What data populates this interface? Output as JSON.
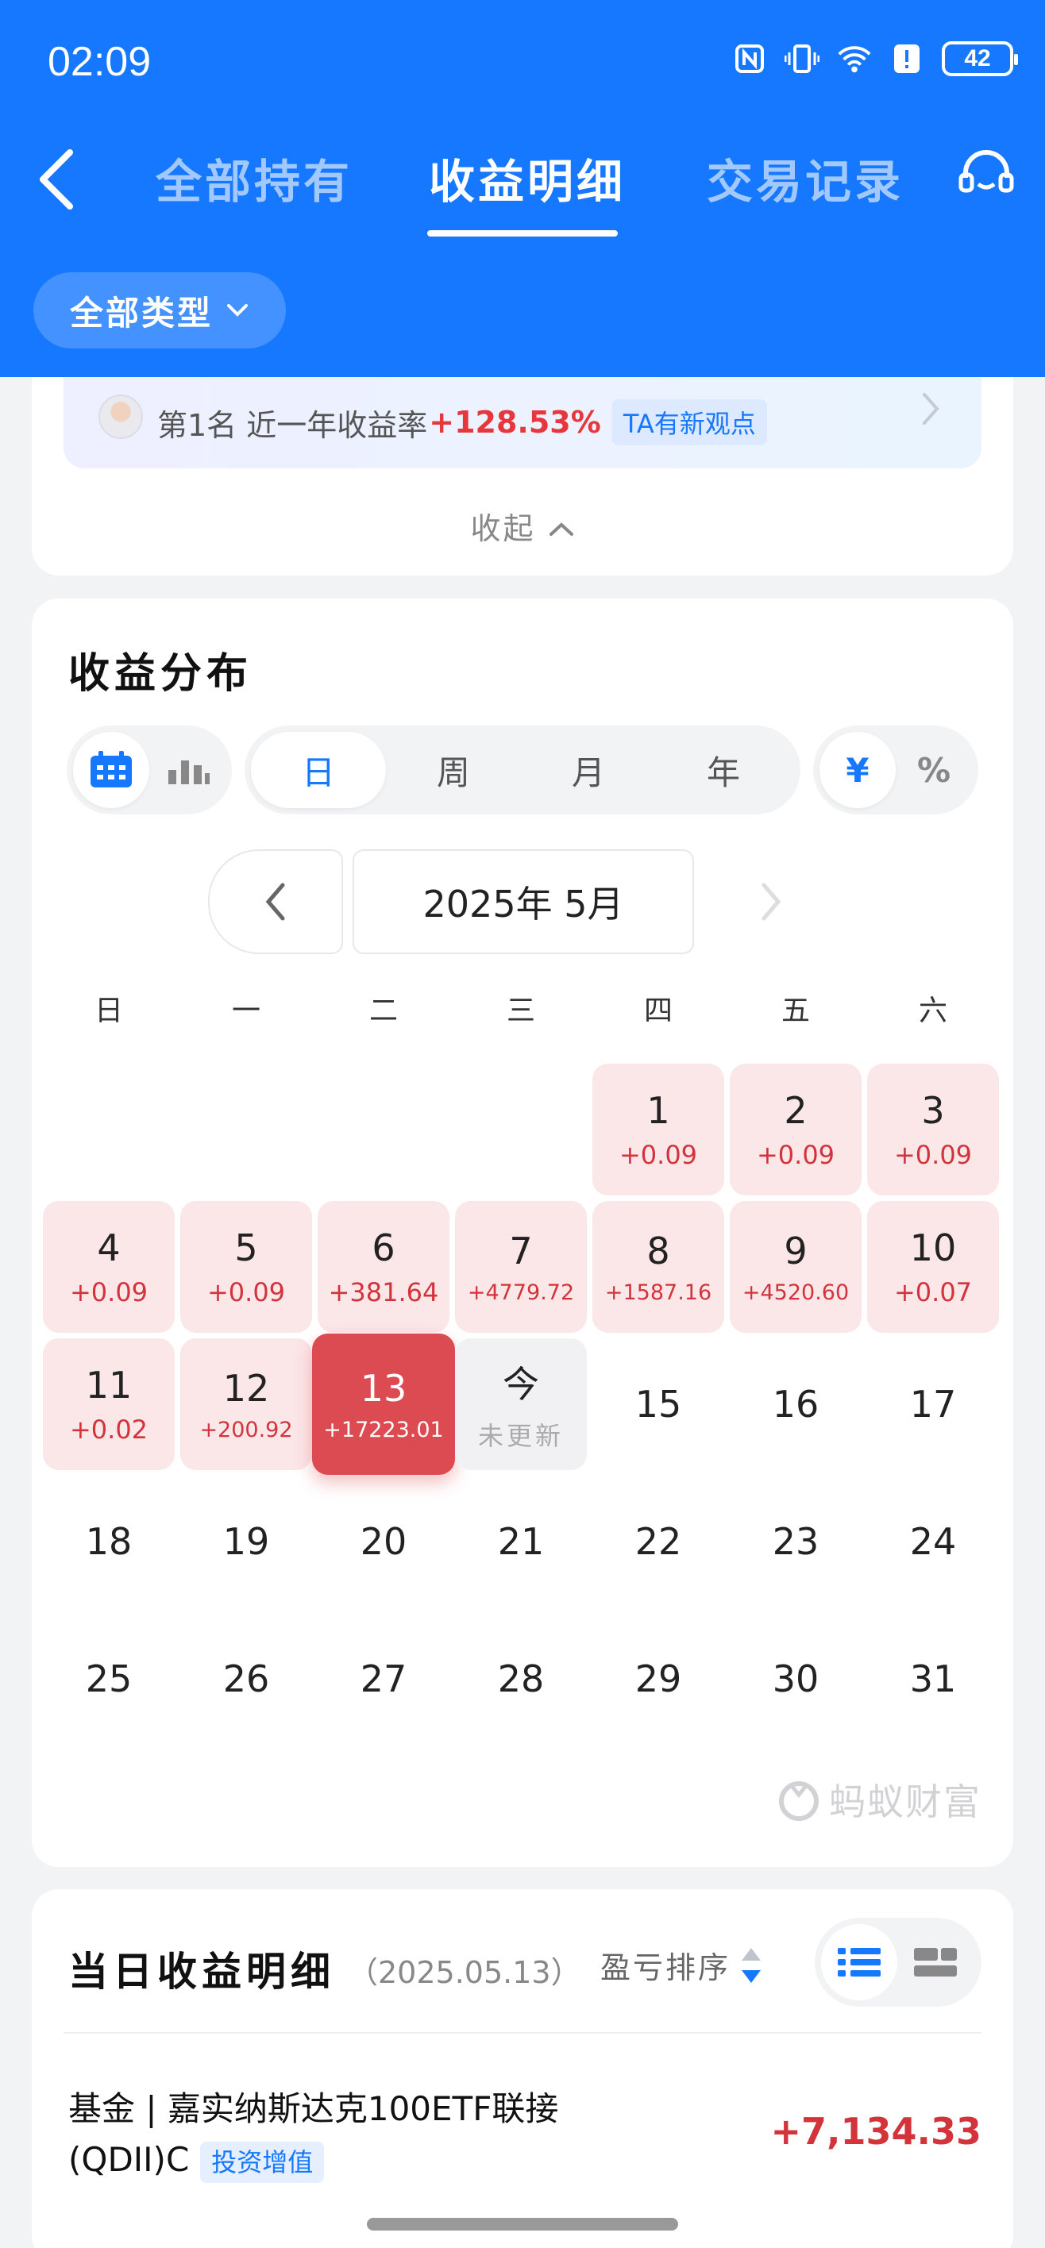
{
  "status": {
    "time": "02:09",
    "battery": "42"
  },
  "nav": {
    "tabs": [
      {
        "label": "全部持有"
      },
      {
        "label": "收益明细"
      },
      {
        "label": "交易记录"
      }
    ]
  },
  "filter": {
    "label": "全部类型"
  },
  "rank": {
    "text": "第1名 近一年收益率",
    "rate": "+128.53%",
    "badge": "TA有新观点",
    "collapse": "收起"
  },
  "calendar": {
    "title": "收益分布",
    "periods": [
      "日",
      "周",
      "月",
      "年"
    ],
    "units": [
      "¥",
      "%"
    ],
    "month": "2025年 5月",
    "weekdays": [
      "日",
      "一",
      "二",
      "三",
      "四",
      "五",
      "六"
    ],
    "days": [
      {
        "d": "1",
        "v": "+0.09"
      },
      {
        "d": "2",
        "v": "+0.09"
      },
      {
        "d": "3",
        "v": "+0.09"
      },
      {
        "d": "4",
        "v": "+0.09"
      },
      {
        "d": "5",
        "v": "+0.09"
      },
      {
        "d": "6",
        "v": "+381.64"
      },
      {
        "d": "7",
        "v": "+4779.72"
      },
      {
        "d": "8",
        "v": "+1587.16"
      },
      {
        "d": "9",
        "v": "+4520.60"
      },
      {
        "d": "10",
        "v": "+0.07"
      },
      {
        "d": "11",
        "v": "+0.02"
      },
      {
        "d": "12",
        "v": "+200.92"
      },
      {
        "d": "13",
        "v": "+17223.01"
      },
      {
        "d": "今",
        "v": "未更新"
      },
      {
        "d": "15",
        "v": ""
      },
      {
        "d": "16",
        "v": ""
      },
      {
        "d": "17",
        "v": ""
      },
      {
        "d": "18",
        "v": ""
      },
      {
        "d": "19",
        "v": ""
      },
      {
        "d": "20",
        "v": ""
      },
      {
        "d": "21",
        "v": ""
      },
      {
        "d": "22",
        "v": ""
      },
      {
        "d": "23",
        "v": ""
      },
      {
        "d": "24",
        "v": ""
      },
      {
        "d": "25",
        "v": ""
      },
      {
        "d": "26",
        "v": ""
      },
      {
        "d": "27",
        "v": ""
      },
      {
        "d": "28",
        "v": ""
      },
      {
        "d": "29",
        "v": ""
      },
      {
        "d": "30",
        "v": ""
      },
      {
        "d": "31",
        "v": ""
      }
    ],
    "brand": "蚂蚁财富"
  },
  "detail": {
    "title": "当日收益明细",
    "date": "（2025.05.13）",
    "sort": "盈亏排序",
    "fund": {
      "name": "基金 | 嘉实纳斯达克100ETF联接(QDII)C",
      "tag": "投资增值",
      "amount": "+7,134.33"
    }
  },
  "colors": {
    "brand_blue": "#1677ff",
    "gain_red": "#d3343c",
    "selected_red": "#dc4a52"
  }
}
